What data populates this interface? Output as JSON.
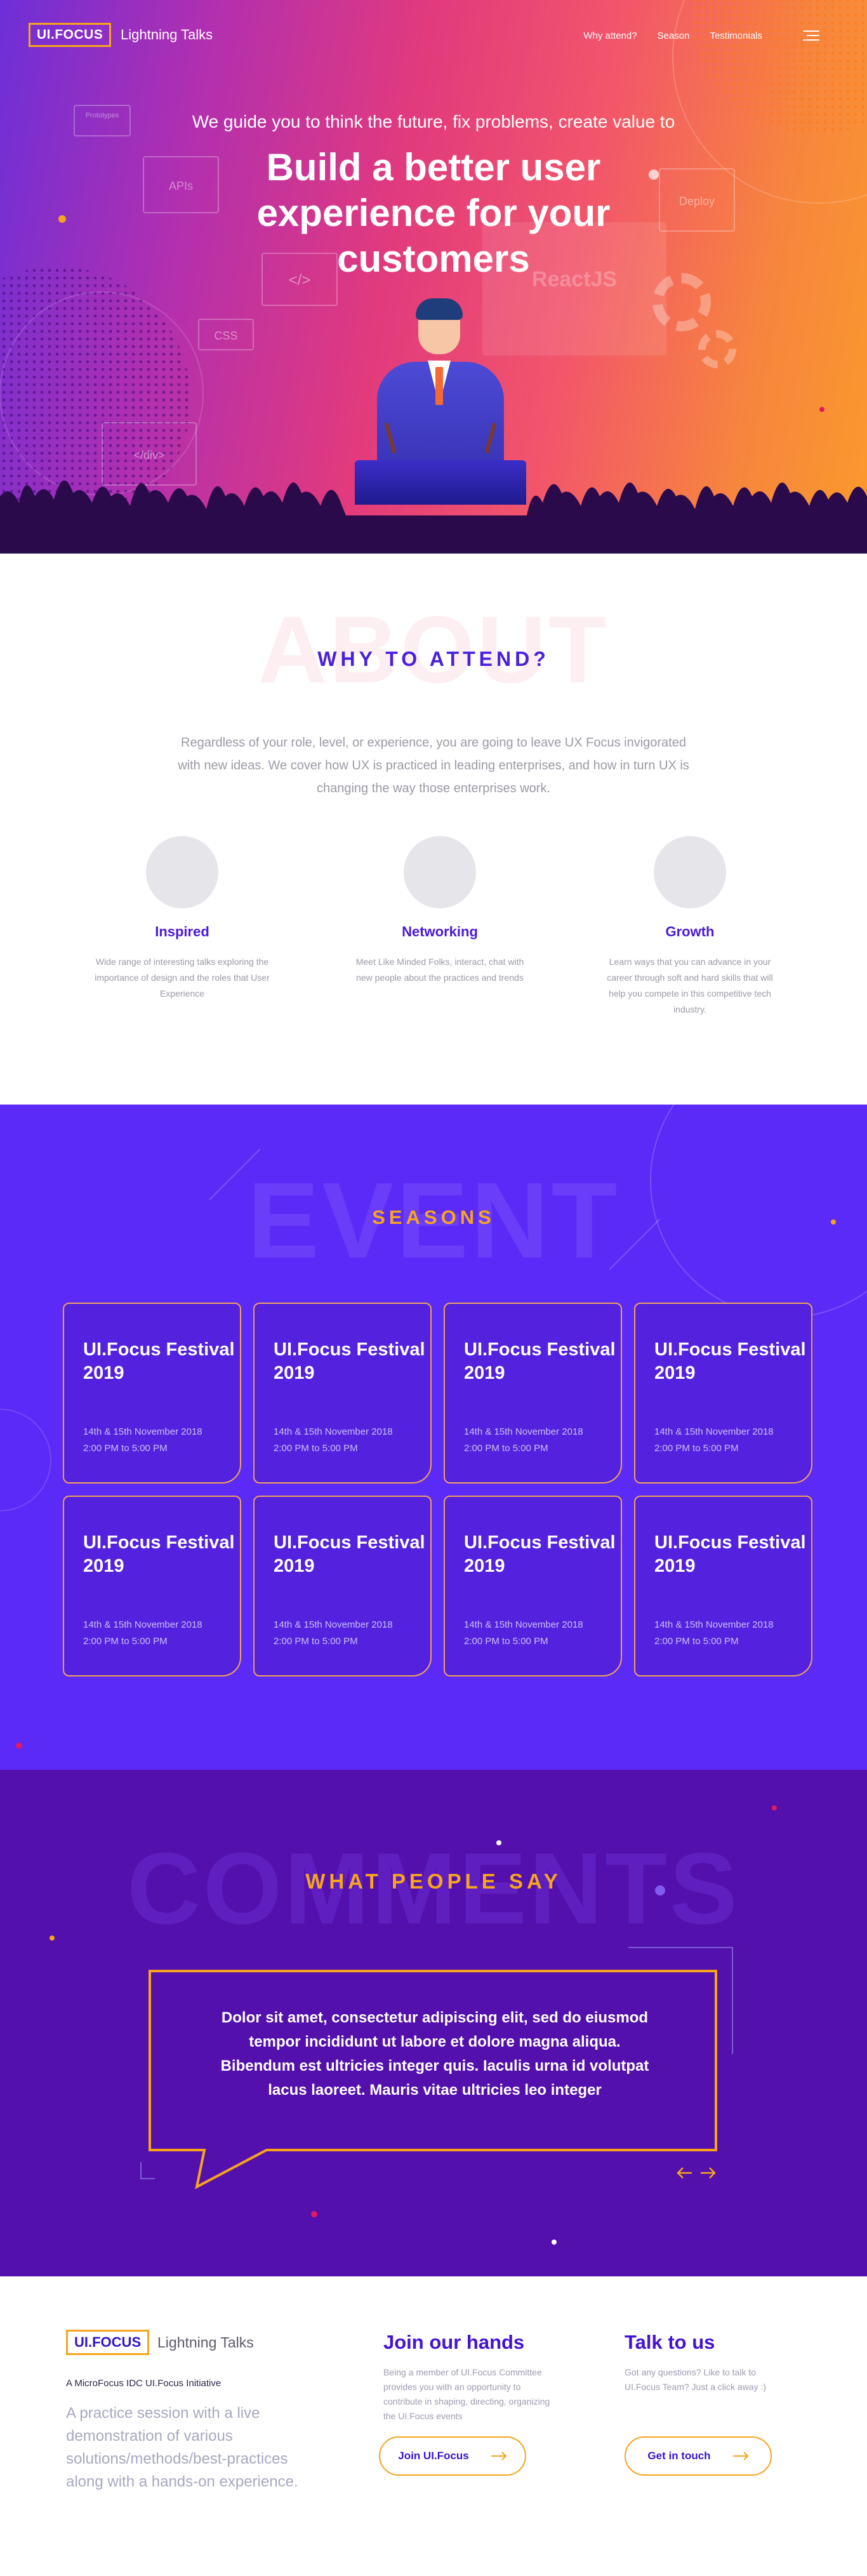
{
  "nav": {
    "logo": "UI.FOCUS",
    "logo_sub": "Lightning Talks",
    "links": [
      "Why attend?",
      "Season",
      "Testimonials"
    ]
  },
  "hero": {
    "tagline": "We guide you to think the future, fix problems, create value to",
    "title": "Build a better user experience for your customers",
    "ghost_labels": [
      "Prototypes",
      "APIs",
      "CSS",
      "Deploy",
      "ReactJS",
      "</>",
      "</div>"
    ]
  },
  "about": {
    "ghost": "ABOUT",
    "title": "WHY TO ATTEND?",
    "text": "Regardless of your role, level, or experience, you are going to leave UX Focus invigorated with new ideas. We cover how UX is practiced in leading enterprises, and how in turn UX is changing the way those enterprises work.",
    "features": [
      {
        "title": "Inspired",
        "text": "Wide range of interesting talks exploring the importance of design and the roles that User Experience"
      },
      {
        "title": "Networking",
        "text": "Meet Like Minded Folks, interact, chat with new people about the practices and trends"
      },
      {
        "title": "Growth",
        "text": "Learn ways that you can advance in your career through soft and hard skills that will help you compete in this competitive tech industry."
      }
    ]
  },
  "events": {
    "ghost": "EVENT",
    "title": "SEASONS",
    "cards": [
      {
        "title": "UI.Focus Festival 2019",
        "date": "14th & 15th November 2018",
        "time": "2:00 PM to 5:00 PM"
      },
      {
        "title": "UI.Focus Festival 2019",
        "date": "14th & 15th November 2018",
        "time": "2:00 PM to 5:00 PM"
      },
      {
        "title": "UI.Focus Festival 2019",
        "date": "14th & 15th November 2018",
        "time": "2:00 PM to 5:00 PM"
      },
      {
        "title": "UI.Focus Festival 2019",
        "date": "14th & 15th November 2018",
        "time": "2:00 PM to 5:00 PM"
      },
      {
        "title": "UI.Focus Festival 2019",
        "date": "14th & 15th November 2018",
        "time": "2:00 PM to 5:00 PM"
      },
      {
        "title": "UI.Focus Festival 2019",
        "date": "14th & 15th November 2018",
        "time": "2:00 PM to 5:00 PM"
      },
      {
        "title": "UI.Focus Festival 2019",
        "date": "14th & 15th November 2018",
        "time": "2:00 PM to 5:00 PM"
      },
      {
        "title": "UI.Focus Festival 2019",
        "date": "14th & 15th November 2018",
        "time": "2:00 PM to 5:00 PM"
      }
    ]
  },
  "comments": {
    "ghost": "COMMENTS",
    "title": "WHAT PEOPLE SAY",
    "quote": "Dolor sit amet, consectetur adipiscing elit, sed do eiusmod tempor incididunt ut labore et dolore magna aliqua. Bibendum est ultricies integer quis. Iaculis urna id volutpat lacus laoreet. Mauris vitae ultricies leo integer"
  },
  "footer": {
    "logo": "UI.FOCUS",
    "logo_sub": "Lightning Talks",
    "initiative": "A MicroFocus IDC UI.Focus Initiative",
    "description": "A practice session with a live demonstration of various solutions/methods/best-practices along with a hands-on experience.",
    "join_title": "Join our hands",
    "join_text": "Being a member of UI.Focus Committee provides you with an opportunity to contribute in shaping, directing, organizing the UI.Focus events",
    "join_button": "Join UI.Focus",
    "talk_title": "Talk to us",
    "talk_text": "Got any questions? Like to talk to UI.Focus Team? Just a click away :)",
    "talk_button": "Get in touch"
  },
  "colors": {
    "accent": "#f7a41d",
    "primary_purple": "#4412d6",
    "events_bg": "#5b2af7",
    "comments_bg": "#5310ad"
  }
}
